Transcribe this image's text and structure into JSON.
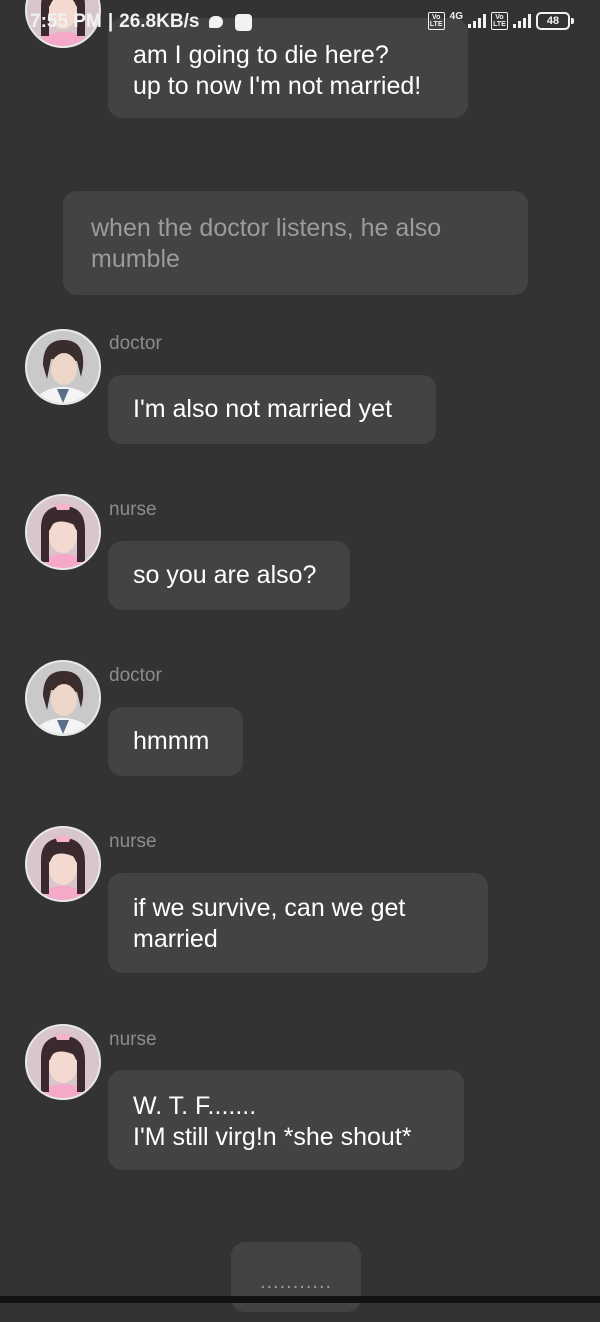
{
  "status_bar": {
    "time": "7:55 PM",
    "separator": "|",
    "speed": "26.8KB/s",
    "sim1_badge": "Vo LTE",
    "network": "4G",
    "sim2_badge": "Vo LTE",
    "battery": "48"
  },
  "messages": [
    {
      "speaker": "",
      "text": "am I going to die here?\nup to now I'm not married!"
    },
    {
      "type": "narration",
      "text": "when the doctor listens,  he also mumble"
    },
    {
      "speaker": "doctor",
      "text": "I'm also not married yet"
    },
    {
      "speaker": "nurse",
      "text": "so you are also?"
    },
    {
      "speaker": "doctor",
      "text": "hmmm"
    },
    {
      "speaker": "nurse",
      "text": "if we survive, can we get married"
    },
    {
      "speaker": "nurse",
      "text": "W. T. F.......\nI'M still virg!n *she shout*"
    }
  ],
  "typing_indicator": "...........",
  "colors": {
    "background": "#333333",
    "bubble": "#434343",
    "name_label": "#8c8c8c",
    "narration_text": "#9b9b9b"
  },
  "icons": {
    "chat": "chat-bubble-icon",
    "app": "app-square-icon",
    "signal": "signal-bars-icon",
    "battery": "battery-icon"
  }
}
